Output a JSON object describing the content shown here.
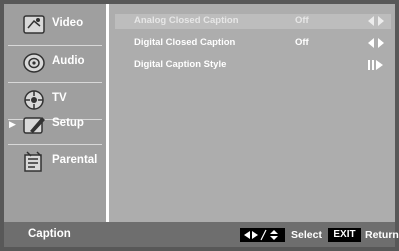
{
  "sidebar": {
    "items": [
      {
        "label": "Video",
        "icon": "video-icon"
      },
      {
        "label": "Audio",
        "icon": "audio-icon"
      },
      {
        "label": "TV",
        "icon": "tv-icon"
      },
      {
        "label": "Setup",
        "icon": "setup-icon",
        "active": true
      },
      {
        "label": "Parental",
        "icon": "parental-icon"
      }
    ]
  },
  "options": [
    {
      "label": "Analog Closed Caption",
      "value": "Off",
      "control": "left-right-arrows",
      "selected": true
    },
    {
      "label": "Digital Closed Caption",
      "value": "Off",
      "control": "left-right-arrows"
    },
    {
      "label": "Digital Caption Style",
      "value": "",
      "control": "enter-arrow"
    }
  ],
  "footer": {
    "title": "Caption",
    "select_label": "Select",
    "exit_key": "EXIT",
    "return_label": "Return"
  },
  "colors": {
    "background": "#adadad",
    "sidebar": "#9f9f9f",
    "footer": "#6e6e6e",
    "border": "#585858",
    "text": "#ffffff"
  }
}
